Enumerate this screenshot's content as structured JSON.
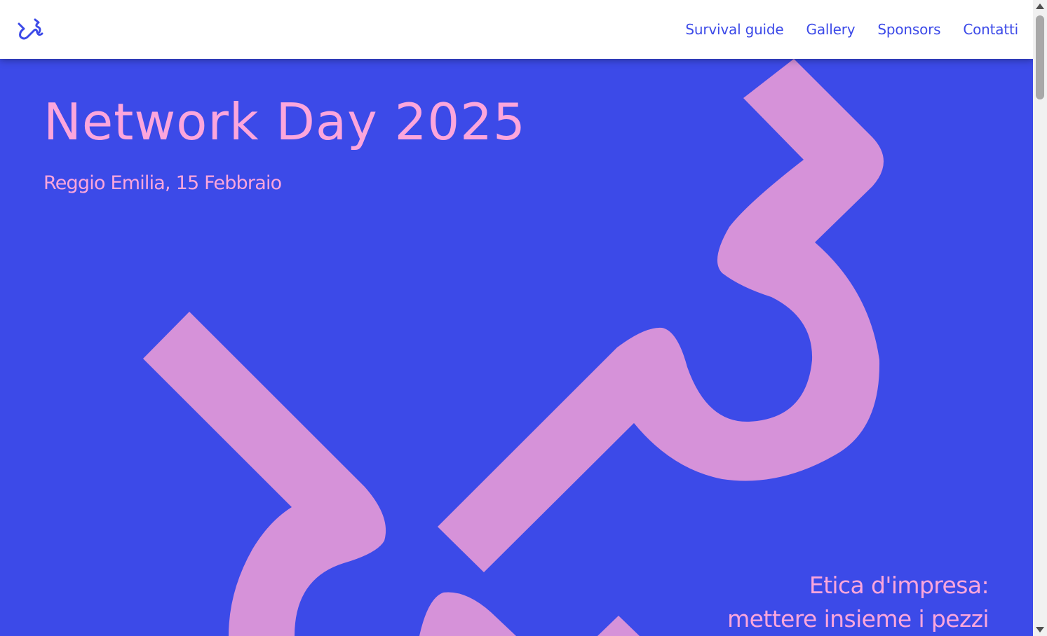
{
  "nav": {
    "logo": "logo-icon",
    "links": [
      {
        "label": "Survival guide"
      },
      {
        "label": "Gallery"
      },
      {
        "label": "Sponsors"
      },
      {
        "label": "Contatti"
      }
    ]
  },
  "hero": {
    "title": "Network Day 2025",
    "subtitle": "Reggio Emilia, 15 Febbraio",
    "tagline": [
      "Etica d'impresa:",
      "mettere insieme i pezzi"
    ],
    "background_color": "#3c4ae8",
    "text_color": "#fca6dc",
    "shape_color": "#d692d9"
  }
}
